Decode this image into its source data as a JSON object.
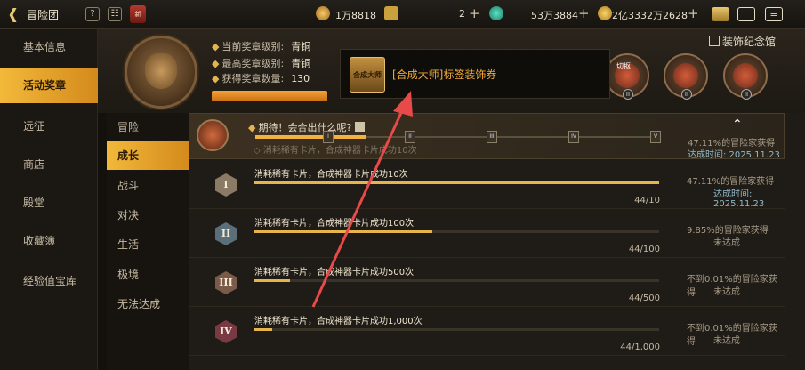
{
  "topbar": {
    "title": "冒险团",
    "badge": "新",
    "resources": [
      {
        "icon": "trophy-icon",
        "value": "1万8818"
      },
      {
        "icon": "coin-c-icon",
        "value": ""
      },
      {
        "icon": "gem-icon",
        "value": "2"
      },
      {
        "icon": "crystal-icon",
        "value": "53万3884"
      },
      {
        "icon": "gold-icon",
        "value": "2亿3332万2628"
      }
    ]
  },
  "sidebar": {
    "items": [
      {
        "label": "基本信息",
        "active": false
      },
      {
        "label": "活动奖章",
        "active": true
      },
      {
        "label": "远征",
        "active": false
      },
      {
        "label": "商店",
        "active": false
      },
      {
        "label": "殿堂",
        "active": false
      },
      {
        "label": "收藏簿",
        "active": false
      },
      {
        "label": "经验值宝库",
        "active": false
      }
    ]
  },
  "subnav": {
    "items": [
      {
        "label": "冒险",
        "active": false
      },
      {
        "label": "成长",
        "active": true
      },
      {
        "label": "战斗",
        "active": false
      },
      {
        "label": "对决",
        "active": false
      },
      {
        "label": "生活",
        "active": false
      },
      {
        "label": "极境",
        "active": false
      },
      {
        "label": "无法达成",
        "active": false
      }
    ]
  },
  "header": {
    "current_level_label": "当前奖章级别:",
    "current_level": "青铜",
    "max_level_label": "最高奖章级别:",
    "max_level": "青铜",
    "count_label": "获得奖章数量:",
    "count": "130",
    "decoration_link": "装饰纪念馆",
    "medal_label": "切抠"
  },
  "tooltip": {
    "thumb_text": "合成大师",
    "text": "[合成大师]标签装饰券"
  },
  "summary": {
    "hint": "期待！会合出什么呢?",
    "sub": "消耗稀有卡片，合成神器卡片成功10次",
    "nodes": [
      "I",
      "II",
      "III",
      "IV",
      "V"
    ],
    "rate": "47.11%的冒险家获得",
    "date": "达成时间: 2025.11.23"
  },
  "rows": [
    {
      "rank": "I",
      "desc": "消耗稀有卡片，合成神器卡片成功10次",
      "progress": 1.0,
      "count": "44/10",
      "rate": "47.11%的冒险家获得",
      "status": "达成时间: 2025.11.23",
      "achieved": true,
      "color": "#8a7a66"
    },
    {
      "rank": "II",
      "desc": "消耗稀有卡片，合成神器卡片成功100次",
      "progress": 0.44,
      "count": "44/100",
      "rate": "9.85%的冒险家获得",
      "status": "未达成",
      "achieved": false,
      "color": "#5a6f7a"
    },
    {
      "rank": "III",
      "desc": "消耗稀有卡片，合成神器卡片成功500次",
      "progress": 0.088,
      "count": "44/500",
      "rate": "不到0.01%的冒险家获得",
      "status": "未达成",
      "achieved": false,
      "color": "#7a5a48"
    },
    {
      "rank": "IV",
      "desc": "消耗稀有卡片，合成神器卡片成功1,000次",
      "progress": 0.044,
      "count": "44/1,000",
      "rate": "不到0.01%的冒险家获得",
      "status": "未达成",
      "achieved": false,
      "color": "#7a3a44"
    }
  ],
  "colors": {
    "accent": "#f2b93a",
    "annotation_arrow": "#e84a4a"
  }
}
